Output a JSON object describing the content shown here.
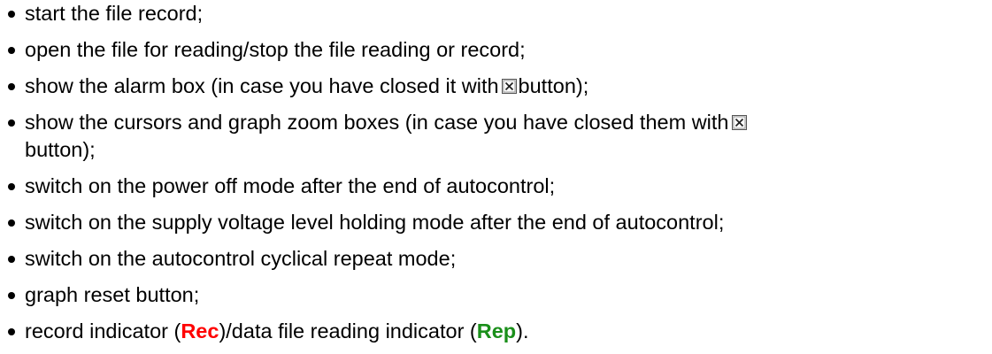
{
  "items": [
    {
      "text": "start the file record;"
    },
    {
      "text": "open the file for reading/stop the file reading or record;"
    },
    {
      "before": "show the alarm box (in case you have closed it with",
      "after": "button);"
    },
    {
      "before": "show the cursors and graph zoom boxes (in case you have closed them with",
      "after": "button);"
    },
    {
      "text": "switch on the power off mode after the end of autocontrol;"
    },
    {
      "text": "switch on the supply voltage level holding mode after the end of autocontrol;"
    },
    {
      "text": "switch on the autocontrol cyclical repeat mode;"
    },
    {
      "text": "graph reset button;"
    },
    {
      "part1": "record indicator (",
      "rec": "Rec",
      "part2": ")/data file reading indicator (",
      "rep": "Rep",
      "part3": ")."
    }
  ],
  "icons": {
    "close": "close-box-icon"
  },
  "colors": {
    "rec": "#ff0000",
    "rep": "#1a8f1a"
  }
}
